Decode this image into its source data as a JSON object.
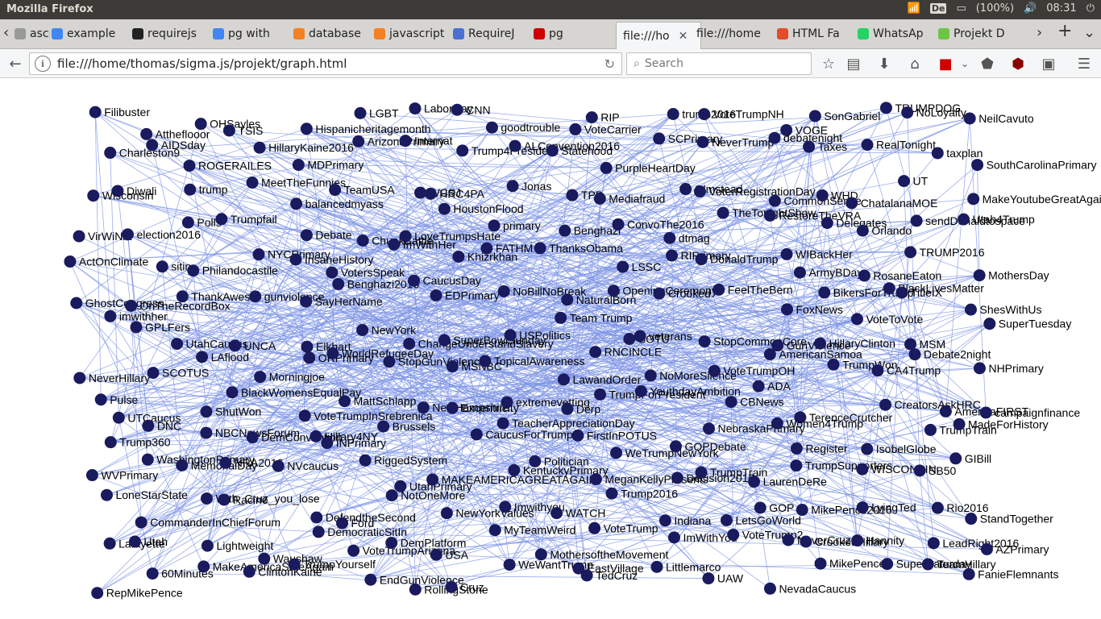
{
  "window": {
    "title": "Mozilla Firefox",
    "keyboard": "De",
    "battery": "(100%)",
    "clock": "08:31"
  },
  "tabs": [
    {
      "label": "ascript",
      "icon_color": "#999999"
    },
    {
      "label": "example",
      "icon_color": "#4285f4"
    },
    {
      "label": "requirejs",
      "icon_color": "#222222"
    },
    {
      "label": "pg with",
      "icon_color": "#4285f4"
    },
    {
      "label": "database",
      "icon_color": "#f48024"
    },
    {
      "label": "javascript",
      "icon_color": "#f48024"
    },
    {
      "label": "RequireJ",
      "icon_color": "#4a6fd0"
    },
    {
      "label": "pg",
      "icon_color": "#cc0000"
    },
    {
      "label": "file:///ho",
      "icon_color": "",
      "active": true
    },
    {
      "label": "file:///home",
      "icon_color": ""
    },
    {
      "label": "HTML Fa",
      "icon_color": "#e34c26"
    },
    {
      "label": "WhatsAp",
      "icon_color": "#25d366"
    },
    {
      "label": "Projekt D",
      "icon_color": "#6cc644"
    }
  ],
  "navbar": {
    "url": "file:///home/thomas/sigma.js/projekt/graph.html",
    "search_placeholder": "Search"
  },
  "icons": [
    "back-icon",
    "info-icon",
    "reload-icon",
    "search-icon",
    "bookmark-star-icon",
    "reading-list-icon",
    "download-icon",
    "home-icon",
    "flash-icon",
    "pocket-icon",
    "ublock-icon",
    "extension-icon",
    "menu-icon"
  ],
  "graph": {
    "node_color": "#1a1a5e",
    "edge_color": "#7c93e6",
    "labels": [
      "Filibuster",
      "Attheflooor",
      "OHSayles",
      "TSIS",
      "Hispanicheritagemonth",
      "LGBT",
      "LaborDay",
      "CNN",
      "goodtrouble",
      "VoteCarrier",
      "RIP",
      "trump2016",
      "VoteTrumpNH",
      "VOGE",
      "SonGabriel",
      "TRUMPDOG",
      "NoLoyalty",
      "NeilCavuto",
      "Charleston9",
      "AIDSday",
      "ROGERAILES",
      "HillaryKaine2016",
      "MDPrimary",
      "ArizonaPrimary",
      "Internat",
      "Trump4President",
      "ALConvention2016",
      "Statehood",
      "PurpleHeartDay",
      "SCPrimary",
      "NeverTrump",
      "debatenight",
      "Taxes",
      "RealTonight",
      "taxplan",
      "SouthCarolinaPrimary",
      "Wisconsin",
      "Diwali",
      "trump",
      "MeetTheFunnies",
      "balancedmyass",
      "TeamUSA",
      "WCSJ",
      "HRC4PA",
      "Jonas",
      "TPP",
      "Mediafraud",
      "Olmstead",
      "VoterRegistrationDay",
      "CommonSense",
      "WHD",
      "ChatalanaMOE",
      "UT",
      "MakeYoutubeGreatAgain",
      "VirWiNia",
      "election2016",
      "Polls",
      "Trumpfail",
      "Debate",
      "ChunkBattle",
      "LoveTrumpsHate",
      "HoustonFlood",
      "primary",
      "Benghazi",
      "ConvoThe2016",
      "dtmag",
      "TheTonightShow",
      "RestoreTheVRA",
      "Delegates",
      "Orlando",
      "sendDonaldtospace",
      "Utah4Trump",
      "ActOnClimate",
      "sitin",
      "Philandocastile",
      "NYCPrimary",
      "InsaneHistory",
      "VotersSpeak",
      "ImWithHer",
      "Khizrkhan",
      "FATHM",
      "ThanksObama",
      "LSSC",
      "RIPrimary",
      "DonaldTrump",
      "WIBackHer",
      "ArmyBDay",
      "RosaneEaton",
      "TRUMP2016",
      "MothersDay",
      "GhostCongress",
      "OnTheRecordBox",
      "ThankAwes",
      "gunviolence",
      "SayHerName",
      "Benghazi2016",
      "CaucusDay",
      "EDPrimary",
      "NoBillNoBreak",
      "NaturalBorn",
      "OpeningCeremony",
      "Crooked",
      "FeelTheBern",
      "FoxNews",
      "BikersForTrump",
      "BlackLivesMatter",
      "TitleIX",
      "ShesWithUs",
      "imwithher",
      "GPLFers",
      "UtahCaucus",
      "UNCA",
      "Elkhart",
      "NewYork",
      "ChangeUnderstandSlavery",
      "SuperBowlSunday",
      "USPolitics",
      "Team Trump",
      "SOTU",
      "veterans",
      "StopCommonCore",
      "GunViolence",
      "HillaryClinton",
      "VoteToVote",
      "MSM",
      "SuperTuesday",
      "NeverHillary",
      "SCOTUS",
      "LAflood",
      "Morningjoe",
      "ORPrimary",
      "WorldRefugeeDay",
      "StopGunViolence",
      "MSNBC",
      "TopicalAwareness",
      "LawandOrder",
      "RNCINCLE",
      "NoMoreSilence",
      "VoteTrumpOH",
      "AmericanSamoa",
      "TrumpWon",
      "CA4Trump",
      "Debate2night",
      "NHPrimary",
      "Pulse",
      "UTCaucus",
      "ShutWon",
      "BlackWomensEqualPay",
      "VoteTrumpInSrebrenica",
      "MattSchlapp",
      "NewHampshire",
      "Excentricity",
      "extremevetting",
      "Derp",
      "TrumpForPresident",
      "YouthdayAmbition",
      "CBNews",
      "ADA",
      "TerenceCrutcher",
      "CreatorsAskHRC",
      "AmericaFIRST",
      "campaignfinance",
      "Trump360",
      "DNC",
      "NBCNewsForum",
      "DemConvention",
      "Hillary4NY",
      "INPrimary",
      "Brussels",
      "CaucusForTrump",
      "TeacherAppreciationDay",
      "FirstInPOTUS",
      "WeTrumpNewYork",
      "GOPDebate",
      "NebraskaPrimary",
      "Women4Trump",
      "Register",
      "IsobelGlobe",
      "TrumpTrain",
      "MadeForHistory",
      "WVPrimary",
      "WashingtonPrimary",
      "MemorialDay",
      "NRA2016",
      "NVcaucus",
      "RiggedSystem",
      "UtahPrimary",
      "MAKEAMERICAGREATAGAIN",
      "KentuckyPrimary",
      "Politician",
      "MeganKellyPresents",
      "Decision2016",
      "TrumpTrain",
      "LaurenDeRe",
      "TrumpSupporters",
      "WISCONSIN",
      "SB50",
      "GIBill",
      "LoneStarState",
      "CommanderInChiefForum",
      "With_Cruz_you_lose",
      "Racine",
      "DefendtheSecond",
      "Ford",
      "NotOneMore",
      "NewYorkValues",
      "Imwithyou",
      "WATCH",
      "Trump2016",
      "Indiana",
      "LetsGoWorld",
      "GOP",
      "MikePence2016",
      "LyingTed",
      "Rio2016",
      "StandTogether",
      "Lafayette",
      "Utah",
      "Lightweight",
      "Waushaw",
      "DemocraticSitIn",
      "VoteTrumpArizona",
      "DemPlatform",
      "USA",
      "MyTeamWeird",
      "MothersoftheMovement",
      "VoteTrump",
      "ImWithYou",
      "VoteTrump2",
      "NeverCruz",
      "CrookedHillary",
      "Hannity",
      "LeadRight2016",
      "AZPrimary",
      "RepMikePence",
      "60Minutes",
      "MakeAmericaSafeAgain",
      "ClintonKaine",
      "TrumpYourself",
      "EndGunViolence",
      "RollingStone",
      "Cruz",
      "WeWantTrump",
      "EastVillage",
      "TedCruz",
      "Littlemarco",
      "UAW",
      "NevadaCaucus",
      "MikePence",
      "SuperSaturday",
      "TeamHillary",
      "FanieFlemnants"
    ]
  }
}
